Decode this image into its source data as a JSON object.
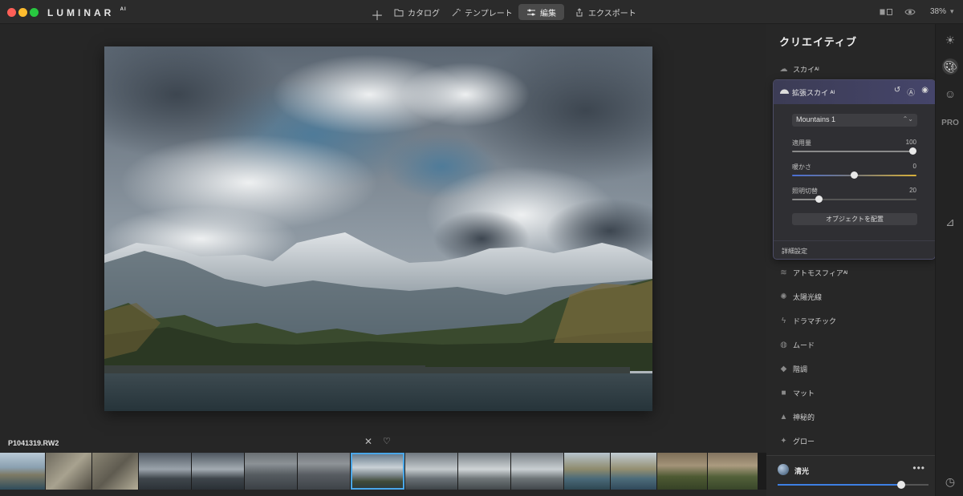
{
  "app": {
    "logo": "LUMINAR",
    "logo_suffix": "AI"
  },
  "nav": {
    "catalog": "カタログ",
    "template": "テンプレート",
    "edit": "編集",
    "export": "エクスポート"
  },
  "view": {
    "zoom": "38%"
  },
  "image": {
    "filename": "P1041319.RW2"
  },
  "panel": {
    "title": "クリエイティブ",
    "tools_above": [
      {
        "label": "スカイᴬᴵ",
        "icon": "cloud-icon"
      }
    ],
    "sky_card": {
      "title": "拡張スカイ ᴬᴵ",
      "dropdown_value": "Mountains 1",
      "sliders": [
        {
          "label": "適用量",
          "value": "100",
          "level": 1.0
        },
        {
          "label": "暖かさ",
          "value": "0",
          "level": 0.5
        },
        {
          "label": "照明切替",
          "value": "20",
          "level": 0.2
        }
      ],
      "place_button": "オブジェクトを配置",
      "advanced": "詳細設定"
    },
    "tools_below": [
      {
        "label": "アトモスフィアᴬᴵ",
        "icon": "atmosphere-icon",
        "glyph": "≋"
      },
      {
        "label": "太陽光線",
        "icon": "sunrays-icon",
        "glyph": "✺"
      },
      {
        "label": "ドラマチック",
        "icon": "dramatic-icon",
        "glyph": "ϟ"
      },
      {
        "label": "ムード",
        "icon": "mood-icon",
        "glyph": "◍"
      },
      {
        "label": "階調",
        "icon": "toning-icon",
        "glyph": "◆"
      },
      {
        "label": "マット",
        "icon": "matte-icon",
        "glyph": "■"
      },
      {
        "label": "神秘的",
        "icon": "mystical-icon",
        "glyph": "▲"
      },
      {
        "label": "グロー",
        "icon": "glow-icon",
        "glyph": "✦"
      }
    ]
  },
  "luminance": {
    "label": "清光",
    "level": 0.82
  },
  "iconbar": {
    "pro": "PRO"
  },
  "colors": {
    "accent": "#3d7fe3",
    "selection": "#4aa7e8"
  }
}
